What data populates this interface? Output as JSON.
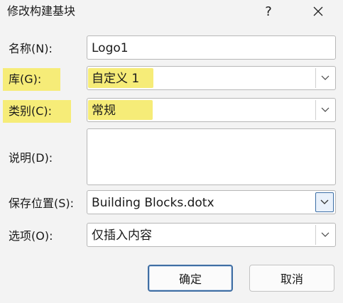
{
  "window": {
    "title": "修改构建基块",
    "help_label": "?"
  },
  "fields": {
    "name": {
      "label": "名称(N):",
      "value": "Logo1"
    },
    "gallery": {
      "label": "库(G):",
      "value": "自定义 1"
    },
    "category": {
      "label": "类别(C):",
      "value": "常规"
    },
    "description": {
      "label": "说明(D):",
      "value": ""
    },
    "save_in": {
      "label": "保存位置(S):",
      "value": "Building Blocks.dotx"
    },
    "options": {
      "label": "选项(O):",
      "value": "仅插入内容"
    }
  },
  "buttons": {
    "ok": "确定",
    "cancel": "取消"
  },
  "colors": {
    "highlight": "#f6ec78",
    "focus_border": "#3f6ea3"
  },
  "icons": {
    "close": "close-icon",
    "dropdown": "chevron-down-icon"
  }
}
